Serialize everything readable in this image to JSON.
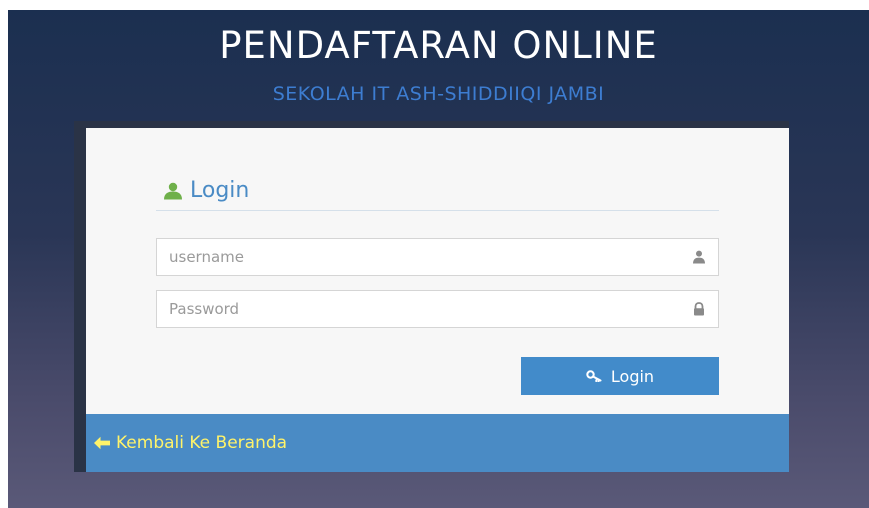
{
  "header": {
    "title": "PENDAFTARAN ONLINE",
    "subtitle": "SEKOLAH IT ASH-SHIDDIIQI JAMBI"
  },
  "login": {
    "heading": "Login",
    "heading_icon": "user-icon",
    "username": {
      "value": "",
      "placeholder": "username",
      "icon": "user-icon"
    },
    "password": {
      "value": "",
      "placeholder": "Password",
      "icon": "lock-icon"
    },
    "submit_label": "Login",
    "submit_icon": "key-icon",
    "back_label": "Kembali Ke Beranda",
    "back_icon": "arrow-left-icon"
  },
  "colors": {
    "heading_blue": "#4a8bc5",
    "subtitle_blue": "#3d7dd1",
    "button_blue": "#428bca",
    "footer_blue": "#4a8bc5",
    "back_link_yellow": "#fff36a",
    "user_icon_green": "#6fb04a"
  }
}
